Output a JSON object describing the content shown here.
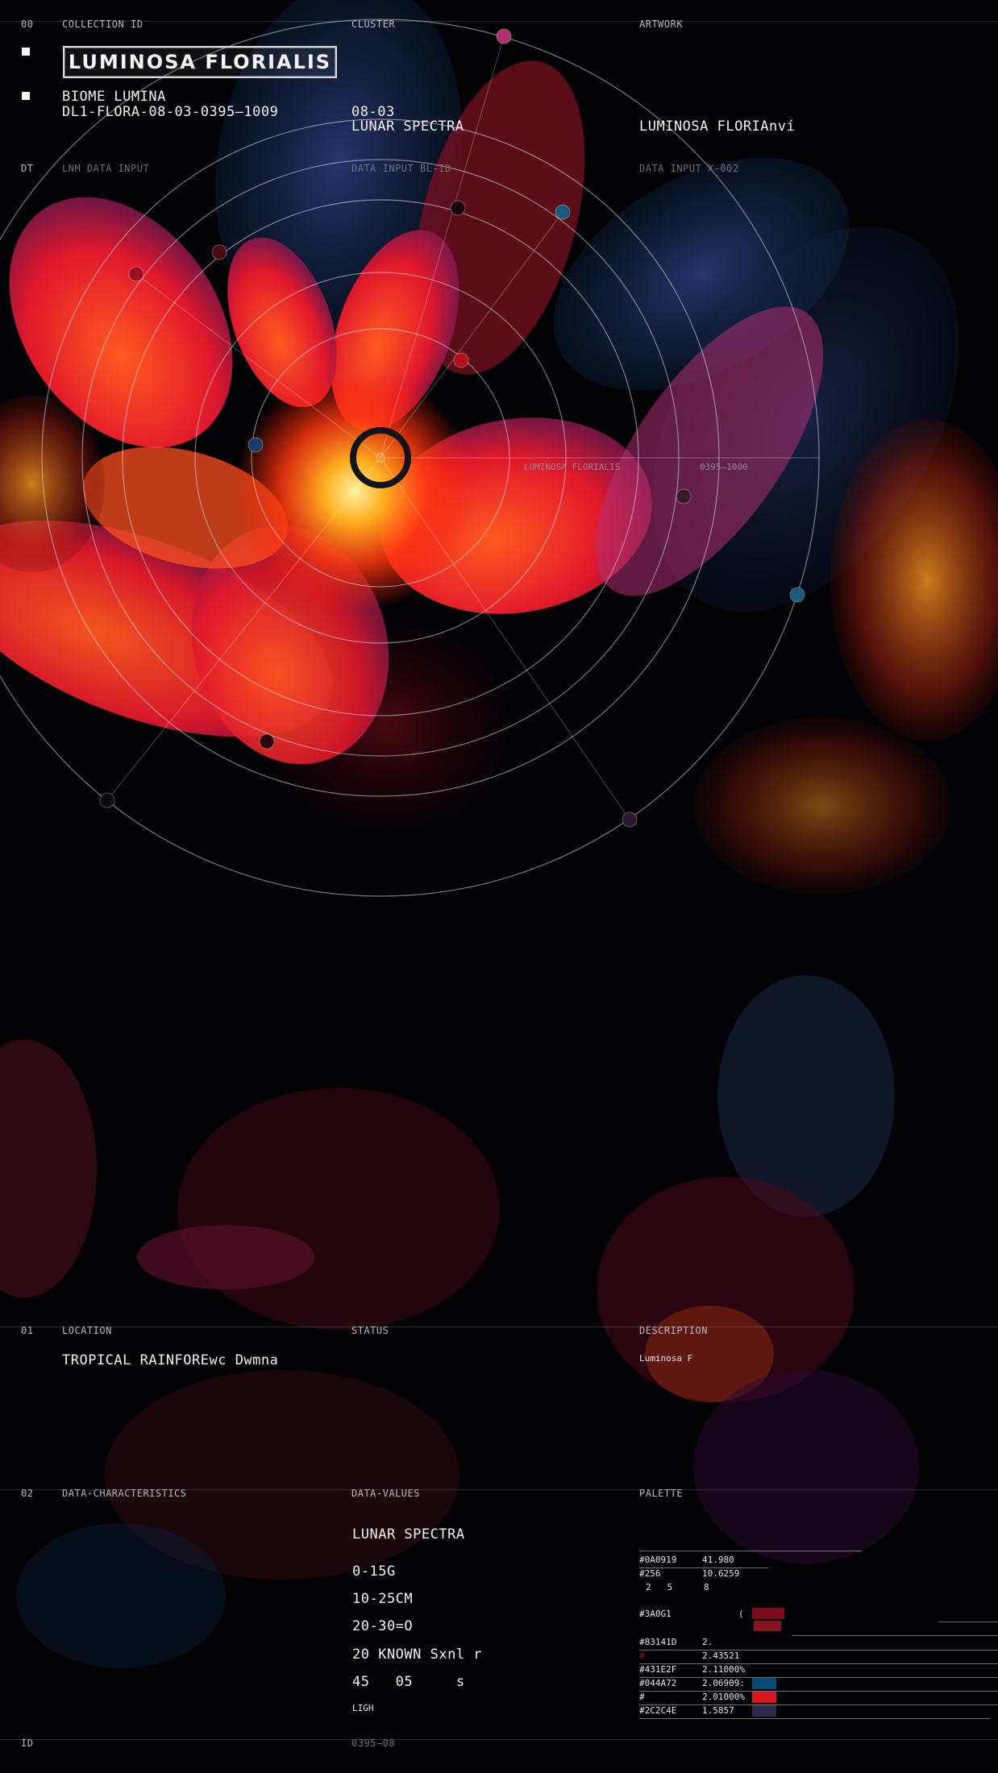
{
  "header": {
    "index": "00",
    "collection_id_label": "COLLECTION ID",
    "cluster_label": "CLUSTER",
    "artwork_label": "ARTWORK",
    "title": "LUMINOSA FLORIALIS",
    "biome": "BIOME LUMINA",
    "code": "DL1-FLORA-08-03-0395–1009",
    "cluster_value_1": "08-03",
    "cluster_value_2": "LUNAR SPECTRA",
    "artwork_value": "LUMINOSA FLORIAnví"
  },
  "data_input_row": {
    "index": "DT",
    "col1": "LNM DATA INPUT",
    "col2": "DATA INPUT BL-ID",
    "col3": "DATA INPUT X-002"
  },
  "reticle": {
    "label_name": "LUMINOSA FLORIALIS",
    "label_code": "0395–1000"
  },
  "location_row": {
    "index": "01",
    "location_label": "LOCATION",
    "status_label": "STATUS",
    "description_label": "DESCRIPTION",
    "location_value": "TROPICAL RAINFOREwc Dwmna",
    "description_value": "Luminosa F"
  },
  "data_row": {
    "index": "02",
    "characteristics_label": "DATA-CHARACTERISTICS",
    "values_label": "DATA-VALUES",
    "palette_label": "PALETTE",
    "spectra": "LUNAR SPECTRA",
    "values": [
      "0-15G",
      "10-25CM",
      "20-30=O",
      "20 KNOWN Sxnl r",
      "45   05     s"
    ],
    "light": "LIGH"
  },
  "palette": [
    {
      "hex": "#0A0919",
      "val": "41.980"
    },
    {
      "hex": "#256",
      "val": "10.6259"
    },
    {
      "hex": "2   5",
      "val": "8"
    },
    {
      "hex": "#3A0G1",
      "val": "(",
      "color": "#7a0c1c"
    },
    {
      "hex": "#83141D",
      "val": "2.",
      "color": "#83141d"
    },
    {
      "hex": "#",
      "val": "2.43521"
    },
    {
      "hex": "#431E2F",
      "val": "2.11000%"
    },
    {
      "hex": "#044A72",
      "val": "2.06909:",
      "color": "#044a72"
    },
    {
      "hex": "#",
      "val": "2.01000%",
      "color": "#e0141e"
    },
    {
      "hex": "#2C2C4E",
      "val": "1.5857",
      "color": "#2c2c4e"
    }
  ],
  "footer": {
    "index": "ID",
    "code": "0395–08"
  }
}
